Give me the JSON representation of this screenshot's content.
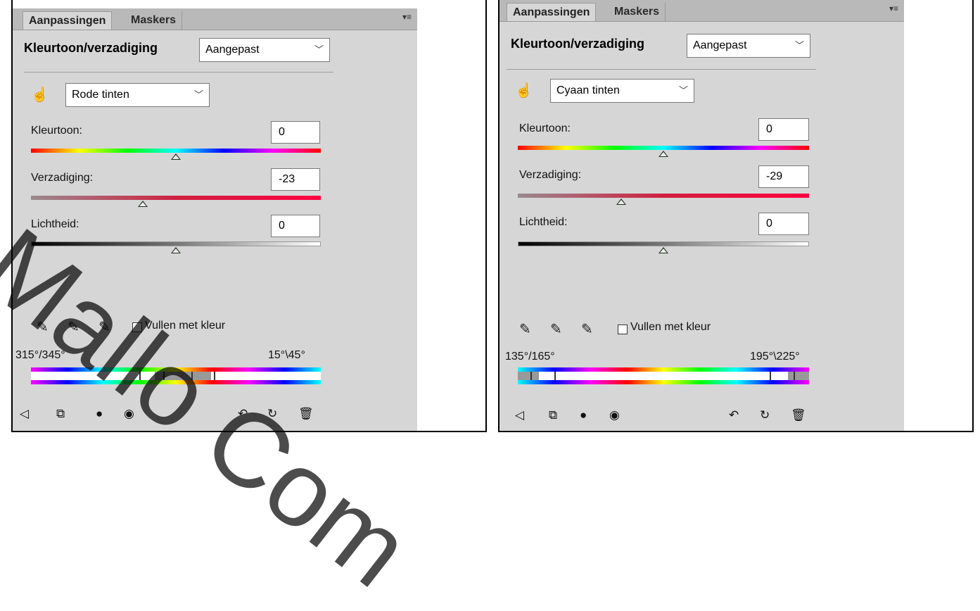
{
  "panels": [
    {
      "tabs": [
        "Aanpassingen",
        "Maskers"
      ],
      "menu_icon": "panel-menu-icon",
      "title": "Kleurtoon/verzadiging",
      "preset": "Aangepast",
      "channel": "Rode tinten",
      "sliders": [
        {
          "label": "Kleurtoon:",
          "value": "0",
          "position": 0.5
        },
        {
          "label": "Verzadiging:",
          "value": "-23",
          "position": 0.385
        },
        {
          "label": "Lichtheid:",
          "value": "0",
          "position": 0.5
        }
      ],
      "colorize_label": "Vullen met kleur",
      "range_left": "315°/345°",
      "range_right": "15°\\45°"
    },
    {
      "tabs": [
        "Aanpassingen",
        "Maskers"
      ],
      "menu_icon": "panel-menu-icon",
      "title": "Kleurtoon/verzadiging",
      "preset": "Aangepast",
      "channel": "Cyaan tinten",
      "sliders": [
        {
          "label": "Kleurtoon:",
          "value": "0",
          "position": 0.5
        },
        {
          "label": "Verzadiging:",
          "value": "-29",
          "position": 0.355
        },
        {
          "label": "Lichtheid:",
          "value": "0",
          "position": 0.5
        }
      ],
      "colorize_label": "Vullen met kleur",
      "range_left": "135°/165°",
      "range_right": "195°\\225°"
    }
  ],
  "watermark": "Mallo Com",
  "icons": [
    "hand-adjust-icon",
    "eyedropper-icon",
    "eyedropper-plus-icon",
    "eyedropper-minus-icon",
    "back-arrow-icon",
    "clip-to-layer-icon",
    "visibility-toggle-icon",
    "view-previous-icon",
    "reset-icon",
    "delete-icon"
  ]
}
